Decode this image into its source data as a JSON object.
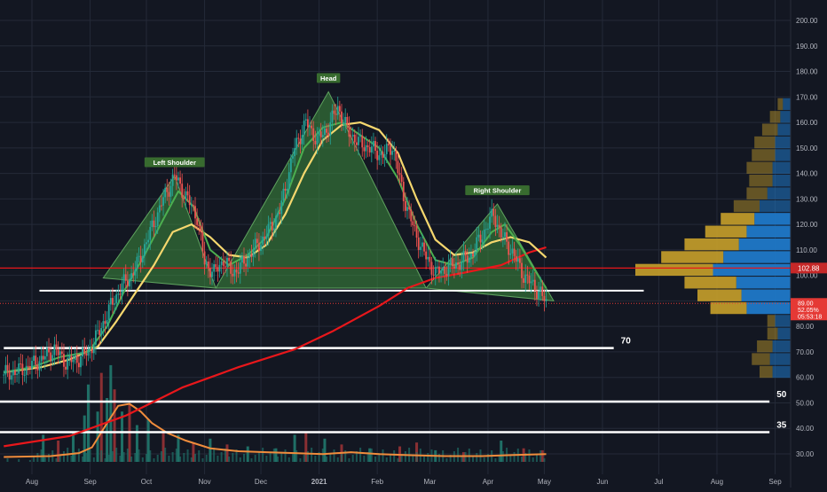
{
  "chart_data": {
    "type": "candlestick",
    "pattern": "head-and-shoulders",
    "colors": {
      "background": "#131722",
      "grid": "#242a38",
      "axis_text": "#b2b5be",
      "candle_up": "#26a69a",
      "candle_down": "#ef5350",
      "volume_up": "#1f6f66",
      "volume_down": "#8a2f33",
      "ma200": "#e8171b",
      "ma_fast": "#4caf50",
      "ma_slow": "#f5d76e",
      "volume_ma": "#f08c3c",
      "pattern_fill": "#3e8e3e",
      "pattern_label_bg": "#386b2f",
      "pattern_label_text": "#ffffff",
      "levels": "#ffffff",
      "vp_up": "#1f78c8",
      "vp_down": "#c8a02a",
      "current_price_bg": "#e53935",
      "ma_price_bg": "#c62828"
    },
    "x_ticks": [
      {
        "label": "Aug",
        "t": 0
      },
      {
        "label": "Sep",
        "t": 31
      },
      {
        "label": "Oct",
        "t": 61
      },
      {
        "label": "Nov",
        "t": 92
      },
      {
        "label": "Dec",
        "t": 122
      },
      {
        "label": "2021",
        "t": 153
      },
      {
        "label": "Feb",
        "t": 184
      },
      {
        "label": "Mar",
        "t": 212
      },
      {
        "label": "Apr",
        "t": 243
      },
      {
        "label": "May",
        "t": 273
      },
      {
        "label": "Jun",
        "t": 304
      },
      {
        "label": "Jul",
        "t": 334
      },
      {
        "label": "Aug",
        "t": 365
      },
      {
        "label": "Sep",
        "t": 396
      }
    ],
    "y_ticks": [
      30.0,
      40.0,
      50.0,
      60.0,
      70.0,
      80.0,
      90.0,
      100.0,
      110.0,
      120.0,
      130.0,
      140.0,
      150.0,
      160.0,
      170.0,
      180.0,
      190.0,
      200.0
    ],
    "y_range": [
      22,
      208
    ],
    "price_path": [
      [
        -15,
        61
      ],
      [
        -5,
        63
      ],
      [
        5,
        67
      ],
      [
        12,
        71
      ],
      [
        18,
        66
      ],
      [
        24,
        67
      ],
      [
        30,
        70
      ],
      [
        36,
        78
      ],
      [
        42,
        88
      ],
      [
        48,
        96
      ],
      [
        52,
        99
      ],
      [
        56,
        104
      ],
      [
        62,
        115
      ],
      [
        70,
        130
      ],
      [
        76,
        139
      ],
      [
        82,
        131
      ],
      [
        88,
        123
      ],
      [
        92,
        105
      ],
      [
        97,
        101
      ],
      [
        102,
        106
      ],
      [
        107,
        101
      ],
      [
        112,
        104
      ],
      [
        118,
        110
      ],
      [
        124,
        115
      ],
      [
        132,
        125
      ],
      [
        140,
        150
      ],
      [
        146,
        160
      ],
      [
        152,
        153
      ],
      [
        158,
        158
      ],
      [
        163,
        166
      ],
      [
        168,
        157
      ],
      [
        174,
        152
      ],
      [
        180,
        150
      ],
      [
        187,
        147
      ],
      [
        192,
        151
      ],
      [
        198,
        131
      ],
      [
        204,
        117
      ],
      [
        210,
        107
      ],
      [
        215,
        101
      ],
      [
        222,
        103
      ],
      [
        228,
        105
      ],
      [
        234,
        108
      ],
      [
        240,
        116
      ],
      [
        246,
        124
      ],
      [
        250,
        116
      ],
      [
        256,
        109
      ],
      [
        262,
        100
      ],
      [
        267,
        96
      ],
      [
        271,
        93
      ],
      [
        274,
        89
      ]
    ],
    "ma_fast": [
      [
        -15,
        62
      ],
      [
        0,
        64
      ],
      [
        15,
        68
      ],
      [
        30,
        70
      ],
      [
        40,
        80
      ],
      [
        50,
        95
      ],
      [
        60,
        108
      ],
      [
        70,
        122
      ],
      [
        78,
        133
      ],
      [
        86,
        127
      ],
      [
        95,
        110
      ],
      [
        105,
        104
      ],
      [
        115,
        108
      ],
      [
        125,
        115
      ],
      [
        135,
        130
      ],
      [
        145,
        150
      ],
      [
        155,
        158
      ],
      [
        165,
        160
      ],
      [
        175,
        155
      ],
      [
        185,
        150
      ],
      [
        195,
        138
      ],
      [
        205,
        120
      ],
      [
        215,
        106
      ],
      [
        225,
        104
      ],
      [
        235,
        107
      ],
      [
        245,
        117
      ],
      [
        252,
        120
      ],
      [
        260,
        112
      ],
      [
        268,
        102
      ],
      [
        274,
        95
      ]
    ],
    "ma_slow": [
      [
        -15,
        62
      ],
      [
        5,
        64
      ],
      [
        20,
        67
      ],
      [
        35,
        72
      ],
      [
        45,
        82
      ],
      [
        55,
        93
      ],
      [
        65,
        104
      ],
      [
        75,
        117
      ],
      [
        85,
        120
      ],
      [
        95,
        115
      ],
      [
        105,
        108
      ],
      [
        115,
        107
      ],
      [
        125,
        112
      ],
      [
        135,
        124
      ],
      [
        145,
        140
      ],
      [
        155,
        153
      ],
      [
        165,
        159
      ],
      [
        175,
        160
      ],
      [
        185,
        157
      ],
      [
        195,
        148
      ],
      [
        205,
        130
      ],
      [
        215,
        114
      ],
      [
        225,
        108
      ],
      [
        235,
        109
      ],
      [
        245,
        113
      ],
      [
        255,
        115
      ],
      [
        265,
        113
      ],
      [
        274,
        107
      ]
    ],
    "ma200": [
      [
        -15,
        33
      ],
      [
        20,
        37
      ],
      [
        50,
        45
      ],
      [
        80,
        56
      ],
      [
        110,
        64
      ],
      [
        140,
        71
      ],
      [
        160,
        78
      ],
      [
        185,
        88
      ],
      [
        200,
        95
      ],
      [
        215,
        99
      ],
      [
        230,
        101
      ],
      [
        250,
        104
      ],
      [
        265,
        109
      ],
      [
        274,
        111
      ]
    ],
    "volume_ma": [
      [
        -15,
        5
      ],
      [
        10,
        6
      ],
      [
        25,
        9
      ],
      [
        32,
        15
      ],
      [
        40,
        40
      ],
      [
        46,
        58
      ],
      [
        52,
        60
      ],
      [
        58,
        52
      ],
      [
        64,
        40
      ],
      [
        72,
        30
      ],
      [
        82,
        22
      ],
      [
        95,
        14
      ],
      [
        110,
        11
      ],
      [
        125,
        10
      ],
      [
        140,
        9
      ],
      [
        155,
        8
      ],
      [
        170,
        10
      ],
      [
        185,
        8
      ],
      [
        200,
        7
      ],
      [
        220,
        6
      ],
      [
        240,
        6
      ],
      [
        255,
        7
      ],
      [
        274,
        8
      ]
    ],
    "volume_bars": [
      {
        "t": 6,
        "v": 28,
        "up": true
      },
      {
        "t": 14,
        "v": 22,
        "up": false
      },
      {
        "t": 22,
        "v": 30,
        "up": true
      },
      {
        "t": 28,
        "v": 48,
        "up": true
      },
      {
        "t": 30,
        "v": 80,
        "up": true
      },
      {
        "t": 35,
        "v": 52,
        "up": true
      },
      {
        "t": 37,
        "v": 92,
        "up": false
      },
      {
        "t": 40,
        "v": 66,
        "up": true
      },
      {
        "t": 42,
        "v": 100,
        "up": true
      },
      {
        "t": 44,
        "v": 75,
        "up": false
      },
      {
        "t": 48,
        "v": 52,
        "up": true
      },
      {
        "t": 52,
        "v": 60,
        "up": false
      },
      {
        "t": 56,
        "v": 38,
        "up": true
      },
      {
        "t": 62,
        "v": 44,
        "up": true
      },
      {
        "t": 70,
        "v": 30,
        "up": false
      },
      {
        "t": 78,
        "v": 28,
        "up": true
      },
      {
        "t": 86,
        "v": 20,
        "up": false
      },
      {
        "t": 95,
        "v": 24,
        "up": true
      },
      {
        "t": 104,
        "v": 18,
        "up": false
      },
      {
        "t": 115,
        "v": 16,
        "up": true
      },
      {
        "t": 130,
        "v": 14,
        "up": true
      },
      {
        "t": 140,
        "v": 28,
        "up": true
      },
      {
        "t": 146,
        "v": 30,
        "up": false
      },
      {
        "t": 156,
        "v": 24,
        "up": true
      },
      {
        "t": 165,
        "v": 18,
        "up": false
      },
      {
        "t": 180,
        "v": 14,
        "up": true
      },
      {
        "t": 196,
        "v": 16,
        "up": false
      },
      {
        "t": 205,
        "v": 20,
        "up": false
      },
      {
        "t": 215,
        "v": 12,
        "up": true
      },
      {
        "t": 230,
        "v": 10,
        "up": false
      },
      {
        "t": 250,
        "v": 22,
        "up": true
      },
      {
        "t": 262,
        "v": 14,
        "up": false
      },
      {
        "t": 272,
        "v": 12,
        "up": false
      }
    ],
    "volume_max": 110,
    "volume_profile": [
      {
        "p": 62,
        "up": 14,
        "down": 10
      },
      {
        "p": 67,
        "up": 16,
        "down": 14
      },
      {
        "p": 72,
        "up": 14,
        "down": 12
      },
      {
        "p": 77,
        "up": 10,
        "down": 8
      },
      {
        "p": 82,
        "up": 12,
        "down": 6
      },
      {
        "p": 87,
        "up": 34,
        "down": 28
      },
      {
        "p": 92,
        "up": 38,
        "down": 34
      },
      {
        "p": 97,
        "up": 42,
        "down": 40
      },
      {
        "p": 102,
        "up": 60,
        "down": 60
      },
      {
        "p": 107,
        "up": 52,
        "down": 48
      },
      {
        "p": 112,
        "up": 40,
        "down": 42
      },
      {
        "p": 117,
        "up": 34,
        "down": 32
      },
      {
        "p": 122,
        "up": 28,
        "down": 26
      },
      {
        "p": 127,
        "up": 24,
        "down": 20
      },
      {
        "p": 132,
        "up": 18,
        "down": 16
      },
      {
        "p": 137,
        "up": 14,
        "down": 18
      },
      {
        "p": 142,
        "up": 14,
        "down": 20
      },
      {
        "p": 147,
        "up": 12,
        "down": 18
      },
      {
        "p": 152,
        "up": 12,
        "down": 16
      },
      {
        "p": 157,
        "up": 10,
        "down": 12
      },
      {
        "p": 162,
        "up": 8,
        "down": 8
      },
      {
        "p": 167,
        "up": 6,
        "down": 4
      }
    ],
    "vp_max": 120,
    "pattern_triangles": [
      {
        "label": "Left Shoulder",
        "a": [
          38,
          99
        ],
        "peak": [
          76,
          139
        ],
        "b": [
          98,
          95
        ]
      },
      {
        "label": "Head",
        "a": [
          98,
          95
        ],
        "peak": [
          158,
          172
        ],
        "b": [
          210,
          95
        ]
      },
      {
        "label": "Right Shoulder",
        "a": [
          210,
          95
        ],
        "peak": [
          248,
          128
        ],
        "b": [
          278,
          90
        ]
      }
    ],
    "neckline": {
      "t1": 4,
      "t2": 326,
      "price": 94
    },
    "levels": [
      {
        "label": "70",
        "price": 71.5,
        "t1": -15,
        "t2": 310
      },
      {
        "label": "50",
        "price": 50.5,
        "t1": -20,
        "t2": 393
      },
      {
        "label": "35",
        "price": 38.5,
        "t1": -20,
        "t2": 393
      }
    ],
    "price_labels": {
      "ma200": "102.88",
      "current_price": "89.00",
      "current_change": "52.05%",
      "countdown": "05:53:18"
    },
    "current_price": 89.0,
    "ma200_price": 102.88
  }
}
